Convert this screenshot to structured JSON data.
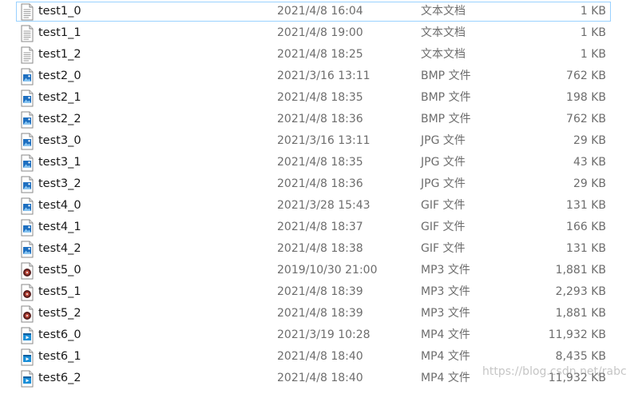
{
  "files": [
    {
      "name": "test1_0",
      "date": "2021/4/8 16:04",
      "type": "文本文档",
      "size": "1 KB",
      "icon": "text-file-icon",
      "selected": true
    },
    {
      "name": "test1_1",
      "date": "2021/4/8 19:00",
      "type": "文本文档",
      "size": "1 KB",
      "icon": "text-file-icon"
    },
    {
      "name": "test1_2",
      "date": "2021/4/8 18:25",
      "type": "文本文档",
      "size": "1 KB",
      "icon": "text-file-icon"
    },
    {
      "name": "test2_0",
      "date": "2021/3/16 13:11",
      "type": "BMP 文件",
      "size": "762 KB",
      "icon": "image-file-icon"
    },
    {
      "name": "test2_1",
      "date": "2021/4/8 18:35",
      "type": "BMP 文件",
      "size": "198 KB",
      "icon": "image-file-icon"
    },
    {
      "name": "test2_2",
      "date": "2021/4/8 18:36",
      "type": "BMP 文件",
      "size": "762 KB",
      "icon": "image-file-icon"
    },
    {
      "name": "test3_0",
      "date": "2021/3/16 13:11",
      "type": "JPG 文件",
      "size": "29 KB",
      "icon": "image-file-icon"
    },
    {
      "name": "test3_1",
      "date": "2021/4/8 18:35",
      "type": "JPG 文件",
      "size": "43 KB",
      "icon": "image-file-icon"
    },
    {
      "name": "test3_2",
      "date": "2021/4/8 18:36",
      "type": "JPG 文件",
      "size": "29 KB",
      "icon": "image-file-icon"
    },
    {
      "name": "test4_0",
      "date": "2021/3/28 15:43",
      "type": "GIF 文件",
      "size": "131 KB",
      "icon": "image-file-icon"
    },
    {
      "name": "test4_1",
      "date": "2021/4/8 18:37",
      "type": "GIF 文件",
      "size": "166 KB",
      "icon": "image-file-icon"
    },
    {
      "name": "test4_2",
      "date": "2021/4/8 18:38",
      "type": "GIF 文件",
      "size": "131 KB",
      "icon": "image-file-icon"
    },
    {
      "name": "test5_0",
      "date": "2019/10/30 21:00",
      "type": "MP3 文件",
      "size": "1,881 KB",
      "icon": "audio-file-icon"
    },
    {
      "name": "test5_1",
      "date": "2021/4/8 18:39",
      "type": "MP3 文件",
      "size": "2,293 KB",
      "icon": "audio-file-icon"
    },
    {
      "name": "test5_2",
      "date": "2021/4/8 18:39",
      "type": "MP3 文件",
      "size": "1,881 KB",
      "icon": "audio-file-icon"
    },
    {
      "name": "test6_0",
      "date": "2021/3/19 10:28",
      "type": "MP4 文件",
      "size": "11,932 KB",
      "icon": "video-file-icon"
    },
    {
      "name": "test6_1",
      "date": "2021/4/8 18:40",
      "type": "MP4 文件",
      "size": "8,435 KB",
      "icon": "video-file-icon"
    },
    {
      "name": "test6_2",
      "date": "2021/4/8 18:40",
      "type": "MP4 文件",
      "size": "11,932 KB",
      "icon": "video-file-icon"
    }
  ],
  "watermark": "https://blog.csdn.net/rabc",
  "colors": {
    "selection_border": "#99d1ff",
    "name_text": "#1a1a1a",
    "meta_text": "#6d6d6d"
  }
}
